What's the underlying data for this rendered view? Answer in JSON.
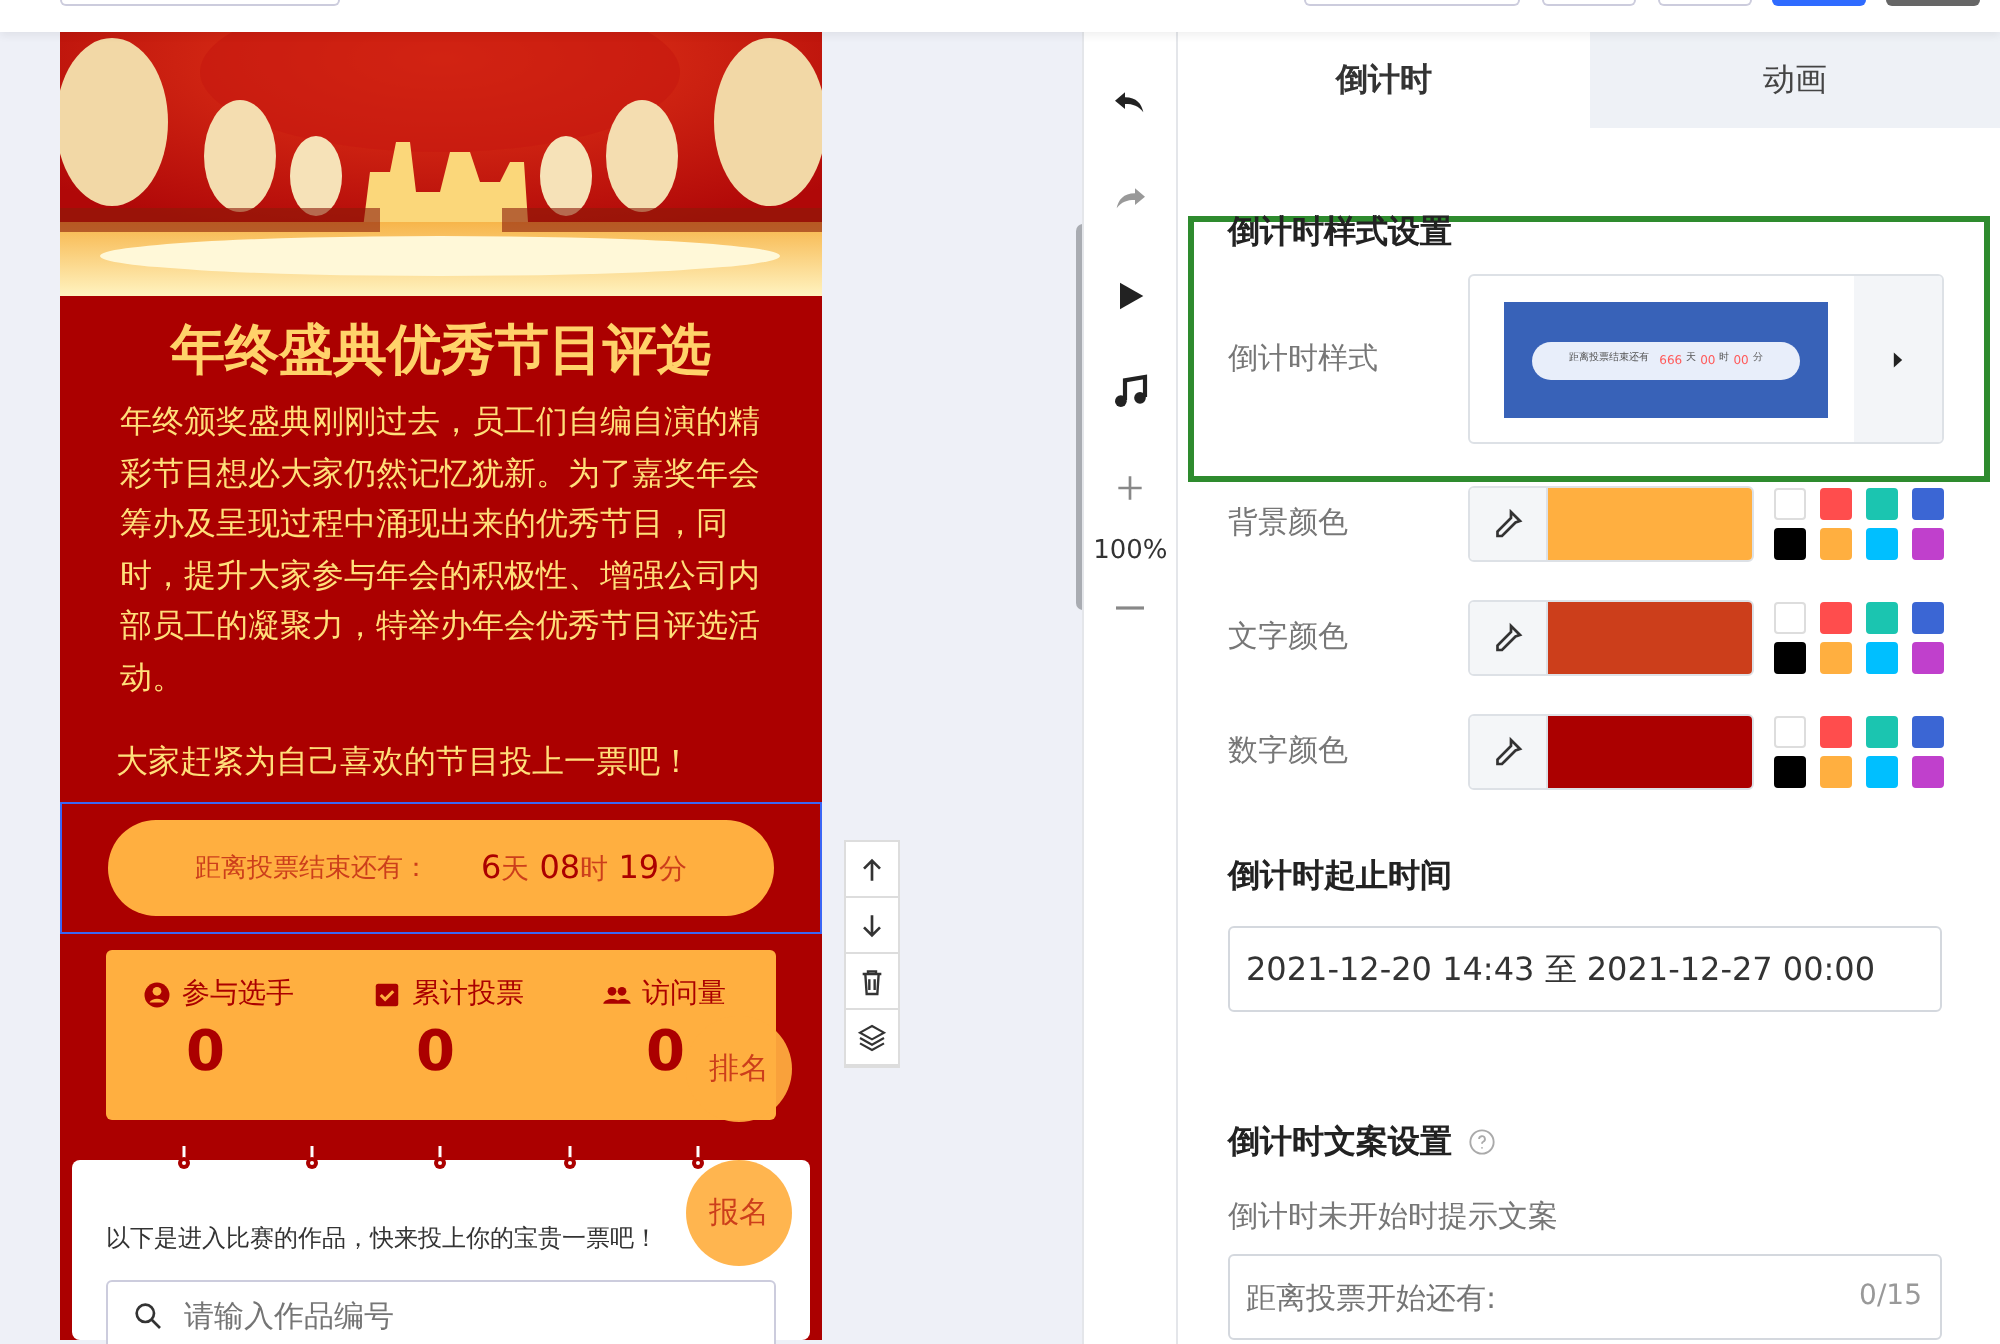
{
  "preview": {
    "title": "年终盛典优秀节目评选",
    "intro": "年终颁奖盛典刚刚过去，员工们自编自演的精彩节目想必大家仍然记忆犹新。为了嘉奖年会筹办及呈现过程中涌现出来的优秀节目，同时，提升大家参与年会的积极性、增强公司内部员工的凝聚力，特举办年会优秀节目评选活动。",
    "call": "大家赶紧为自己喜欢的节目投上一票吧！",
    "countdown": {
      "selected": true,
      "label": "距离投票结束还有：",
      "parts": [
        {
          "kind": "number",
          "text": "6"
        },
        {
          "kind": "unit",
          "text": "天"
        },
        {
          "kind": "number",
          "text": "08"
        },
        {
          "kind": "unit",
          "text": "时"
        },
        {
          "kind": "number",
          "text": "19"
        },
        {
          "kind": "unit",
          "text": "分"
        }
      ]
    },
    "stats": [
      {
        "kind": "person",
        "label": "参与选手",
        "value": "0"
      },
      {
        "kind": "check",
        "label": "累计投票",
        "value": "0"
      },
      {
        "kind": "group",
        "label": "访问量",
        "value": "0"
      }
    ],
    "notice": "以下是进入比赛的作品，快来投上你的宝贵一票吧！",
    "search": {
      "placeholder": "请输入作品编号"
    },
    "float_buttons": [
      "排名",
      "报名"
    ]
  },
  "block_tools": [
    {
      "kind": "up"
    },
    {
      "kind": "down"
    },
    {
      "kind": "delete"
    },
    {
      "kind": "layers"
    }
  ],
  "tools": [
    {
      "kind": "undo",
      "disabled": false
    },
    {
      "kind": "redo",
      "disabled": true
    },
    {
      "kind": "play",
      "disabled": false
    },
    {
      "kind": "music",
      "disabled": false
    },
    {
      "kind": "zoom_in",
      "disabled": false
    }
  ],
  "zoom": "100%",
  "panel": {
    "tabs": [
      {
        "label": "倒计时",
        "selected": true
      },
      {
        "label": "动画",
        "selected": false
      }
    ],
    "style_section": {
      "title": "倒计时样式设置",
      "highlighted": true,
      "style_label": "倒计时样式",
      "sample": {
        "label": "距离投票结束还有",
        "parts": [
          {
            "kind": "number",
            "text": "666"
          },
          {
            "kind": "unit",
            "text": "天"
          },
          {
            "kind": "number",
            "text": "00"
          },
          {
            "kind": "unit",
            "text": "时"
          },
          {
            "kind": "number",
            "text": "00"
          },
          {
            "kind": "unit",
            "text": "分"
          }
        ]
      }
    },
    "color_rows": [
      {
        "label": "背景颜色",
        "color": "#ffaf40"
      },
      {
        "label": "文字颜色",
        "color": "#cc3e1b"
      },
      {
        "label": "数字颜色",
        "color": "#ab0000"
      }
    ],
    "swatches": [
      {
        "color": "#ffffff"
      },
      {
        "color": "#ff4d4d"
      },
      {
        "color": "#1bc5b0"
      },
      {
        "color": "#3b66d4"
      },
      {
        "color": "#000000"
      },
      {
        "color": "#ffaf40"
      },
      {
        "color": "#00bfff"
      },
      {
        "color": "#c040cc"
      }
    ],
    "time_section": {
      "title": "倒计时起止时间",
      "value": "2021-12-20 14:43 至 2021-12-27 00:00"
    },
    "text_section": {
      "title": "倒计时文案设置",
      "field_label": "倒计时未开始时提示文案",
      "placeholder": "距离投票开始还有:",
      "count": "0/15"
    }
  }
}
